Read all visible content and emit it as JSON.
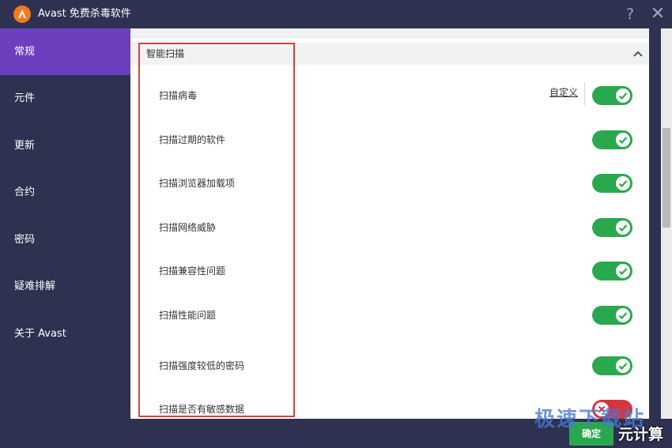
{
  "app": {
    "title": "Avast 免费杀毒软件"
  },
  "titlebar": {
    "help_glyph": "?",
    "close_glyph": "✕"
  },
  "sidebar": {
    "items": [
      {
        "label": "常规",
        "active": true
      },
      {
        "label": "元件",
        "active": false
      },
      {
        "label": "更新",
        "active": false
      },
      {
        "label": "合约",
        "active": false
      },
      {
        "label": "密码",
        "active": false
      },
      {
        "label": "疑难排解",
        "active": false
      },
      {
        "label": "关于 Avast",
        "active": false
      }
    ]
  },
  "section": {
    "title": "智能扫描",
    "custom_link": "自定义",
    "rows": [
      {
        "label": "扫描病毒",
        "enabled": true
      },
      {
        "label": "扫描过期的软件",
        "enabled": true
      },
      {
        "label": "扫描浏览器加载项",
        "enabled": true
      },
      {
        "label": "扫描网络威胁",
        "enabled": true
      },
      {
        "label": "扫描兼容性问题",
        "enabled": true
      },
      {
        "label": "扫描性能问题",
        "enabled": true
      },
      {
        "label": "扫描强度较低的密码",
        "enabled": true
      },
      {
        "label": "扫描是否有敏感数据",
        "enabled": false
      }
    ]
  },
  "footer": {
    "ok_label": "确定"
  },
  "watermark": {
    "line1": "极速下载站",
    "line2": "元计算"
  },
  "colors": {
    "sidebar_bg": "#2e3250",
    "active_item": "#6c3fbe",
    "toggle_on": "#2aa84e",
    "toggle_off": "#d8343f",
    "highlight_border": "#d9403b"
  }
}
